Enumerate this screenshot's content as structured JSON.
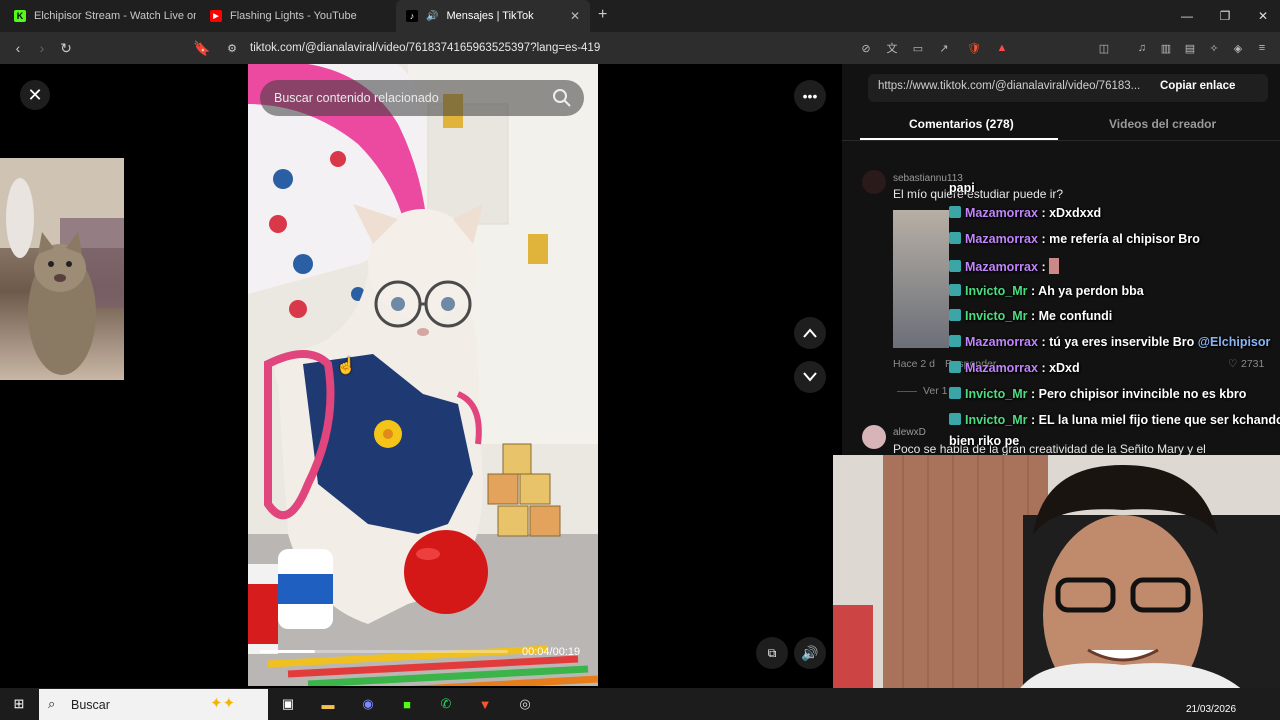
{
  "browser": {
    "tabs": [
      {
        "title": "Elchipisor Stream - Watch Live on Kic",
        "favicon": "kick-icon",
        "color": "#53fc18"
      },
      {
        "title": "Flashing Lights - YouTube",
        "favicon": "youtube-icon",
        "color": "#ff0000"
      },
      {
        "title": "Mensajes | TikTok",
        "favicon": "tiktok-icon",
        "color": "#000000",
        "active": true
      }
    ],
    "new_tab": "+",
    "url": "tiktok.com/@dianalaviral/video/7618374165963525397?lang=es-419"
  },
  "video": {
    "search_placeholder": "Buscar contenido relacionado",
    "timecode": "00:04/00:19",
    "progress": 0.22
  },
  "panel": {
    "link": "https://www.tiktok.com/@dianalaviral/video/76183...",
    "copy_label": "Copiar enlace",
    "tabs": [
      "Comentarios (278)",
      "Videos del creador"
    ],
    "comments": [
      {
        "user": "sebastiannu113",
        "text": "El mío quiere estudiar puede ir?",
        "time": "Hace 2 d",
        "reply": "Responder",
        "likes": "2731",
        "view_replies": "Ver 1"
      },
      {
        "user": "alewxD",
        "text": "Poco se habla de la gran creatividad de la Señito Mary y el"
      }
    ]
  },
  "chat": {
    "top_label": "papi",
    "messages": [
      {
        "user": "Mazamorrax",
        "color": "purple",
        "text": ": xDxdxxd"
      },
      {
        "user": "Mazamorrax",
        "color": "purple",
        "text": ": me refería al chipisor Bro"
      },
      {
        "user": "Mazamorrax",
        "color": "purple",
        "text": ":"
      },
      {
        "user": "Invicto_Mr",
        "color": "green",
        "text": ": Ah ya perdon bba"
      },
      {
        "user": "Invicto_Mr",
        "color": "green",
        "text": ": Me confundi"
      },
      {
        "user": "Mazamorrax",
        "color": "purple",
        "text": ": tú ya eres inservible Bro",
        "mention": "@Elchipisor"
      },
      {
        "user": "Mazamorrax",
        "color": "purple",
        "text": ": xDxd"
      },
      {
        "user": "Invicto_Mr",
        "color": "green",
        "text": ": Pero chipisor invincible no es kbro"
      },
      {
        "user": "Invicto_Mr",
        "color": "green",
        "text": ": EL la luna miel fijo tiene que ser kchando"
      }
    ],
    "wrap": "bien riko pe"
  },
  "taskbar": {
    "search": "Buscar",
    "date": "21/03/2026"
  }
}
